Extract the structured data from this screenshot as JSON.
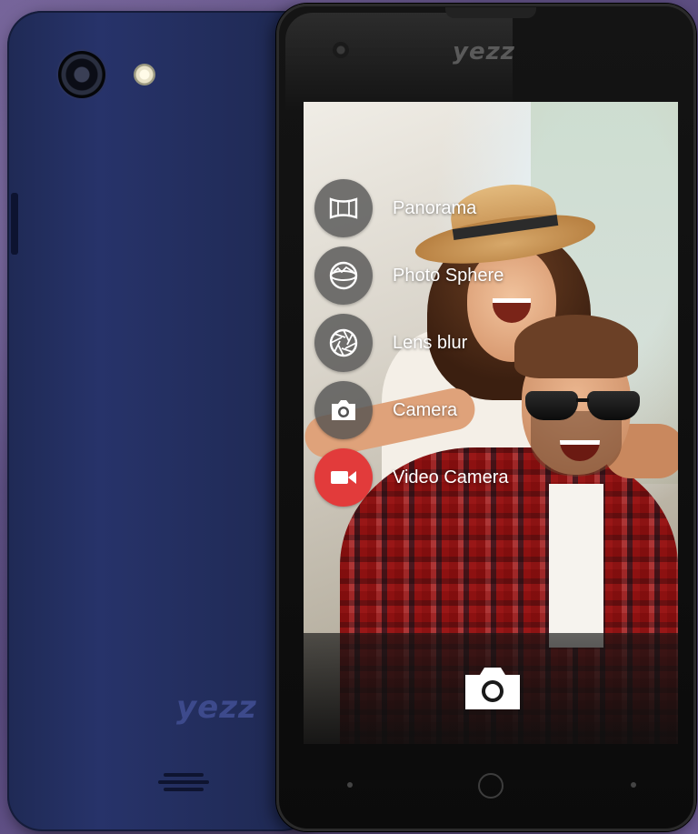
{
  "brand": {
    "back_logo": "yezz",
    "front_logo": "yezz"
  },
  "camera_app": {
    "modes": [
      {
        "label": "Panorama",
        "icon": "panorama-icon",
        "active": false
      },
      {
        "label": "Photo Sphere",
        "icon": "photo-sphere-icon",
        "active": false
      },
      {
        "label": "Lens blur",
        "icon": "lens-blur-icon",
        "active": false
      },
      {
        "label": "Camera",
        "icon": "camera-icon",
        "active": false
      },
      {
        "label": "Video Camera",
        "icon": "video-camera-icon",
        "active": true
      }
    ],
    "shutter_icon": "camera-icon",
    "colors": {
      "mode_icon_bg": "#505050",
      "active_mode_bg": "#e23b3b",
      "label": "#ffffff"
    }
  },
  "device": {
    "back_color": "#22305e",
    "front_color": "#111111"
  }
}
